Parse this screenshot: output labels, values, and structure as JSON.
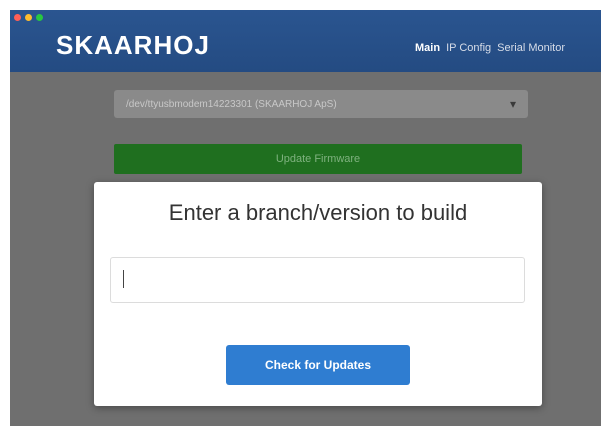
{
  "window": {
    "controls": [
      {
        "name": "close",
        "color": "#ff5f57"
      },
      {
        "name": "minimize",
        "color": "#febc2e"
      },
      {
        "name": "maximize",
        "color": "#28c840"
      }
    ]
  },
  "header": {
    "logo": "SKAARHOJ",
    "nav": [
      {
        "label": "Main",
        "active": true
      },
      {
        "label": "IP Config",
        "active": false
      },
      {
        "label": "Serial Monitor",
        "active": false
      }
    ]
  },
  "device": {
    "selected": "/dev/ttyusbmodem14223301 (SKAARHOJ ApS)",
    "chevron": "chevron-down-icon"
  },
  "update_firmware": {
    "label": "Update Firmware"
  },
  "modal": {
    "title": "Enter a branch/version to build",
    "input_value": "",
    "button_label": "Check for Updates"
  },
  "colors": {
    "header_bg": "#2a5590",
    "overlay_bg": "#6f6f6f",
    "green_button": "#1f6f1f",
    "primary_button": "#2f7dd1"
  }
}
